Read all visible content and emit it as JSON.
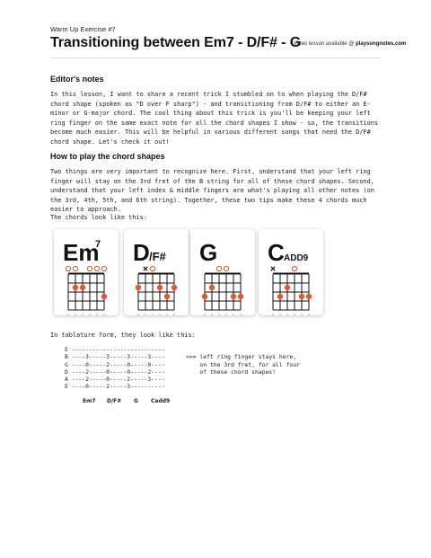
{
  "header": {
    "kicker": "Warm Up Exercise #7",
    "title": "Transitioning between Em7 - D/F# - G",
    "video_prefix": "Video lesson available @ ",
    "video_site": "playsongnotes.com"
  },
  "editors_notes": {
    "heading": "Editor's notes",
    "body": "In this lesson, I want to share a recent trick I stumbled on to when playing the D/F# chord shape (spoken as \"D over F sharp\") - and transitioning from D/F# to either an E-minor or G-major chord. The cool thing about this trick is you'll be keeping your left ring finger on the same exact note for all the chord shapes I show - so, the transitions become much easier. This will be helpful in various different songs that need the D/F# chord shape. Let's check it out!"
  },
  "how_to": {
    "heading": "How to play the chord shapes",
    "body": "Two things are very important to recognize here. First, understand that your left ring finger will stay on the 3rd fret of the B string for all of these chord shapes. Second, understand that your left index & middle fingers are what's playing all other notes (on the 3rd, 4th, 5th, and 6th string). Together, these two tips make these 4 chords much easier to approach.",
    "chords_intro": "The chords look like this:",
    "tab_intro": "In tablature form, they look like this:"
  },
  "colors": {
    "dot": "#e8562e",
    "open": "#e8562e",
    "grid": "#111111"
  },
  "chords": [
    {
      "name": "Em7",
      "main": "Em",
      "sup": "7",
      "sub": "",
      "markers": [
        "o",
        "o",
        "",
        "o",
        "o",
        "o"
      ],
      "dots": [
        {
          "s": 1,
          "f": 2
        },
        {
          "s": 2,
          "f": 2
        },
        {
          "s": 5,
          "f": 3
        }
      ]
    },
    {
      "name": "D/F#",
      "main": "D",
      "sup": "",
      "sub": "/F#",
      "markers": [
        "",
        "x",
        "o",
        "",
        "",
        ""
      ],
      "dots": [
        {
          "s": 0,
          "f": 2
        },
        {
          "s": 3,
          "f": 2
        },
        {
          "s": 4,
          "f": 3
        },
        {
          "s": 5,
          "f": 2
        }
      ]
    },
    {
      "name": "G",
      "main": "G",
      "sup": "",
      "sub": "",
      "markers": [
        "",
        "",
        "o",
        "o",
        "",
        ""
      ],
      "dots": [
        {
          "s": 0,
          "f": 3
        },
        {
          "s": 1,
          "f": 2
        },
        {
          "s": 4,
          "f": 3
        },
        {
          "s": 5,
          "f": 3
        }
      ]
    },
    {
      "name": "Cadd9",
      "main": "C",
      "sup": "",
      "sub": "ADD9",
      "markers": [
        "x",
        "",
        "",
        "o",
        "",
        ""
      ],
      "dots": [
        {
          "s": 1,
          "f": 3
        },
        {
          "s": 2,
          "f": 2
        },
        {
          "s": 4,
          "f": 3
        },
        {
          "s": 5,
          "f": 3
        }
      ]
    }
  ],
  "tab": {
    "lines": [
      "E ---------------------------",
      "B ----3-----3-----3-----3----",
      "G ----0-----2-----0-----0----",
      "D ----2-----0-----0-----2----",
      "A ----2-----0-----2-----3----",
      "E ----0-----2-----3----------"
    ],
    "note": "<== left ring finger stays here,\n    on the 3rd fret, for all four\n    of these chord shapes!",
    "names": [
      "Em7",
      "D/F#",
      "G",
      "Cadd9"
    ]
  }
}
